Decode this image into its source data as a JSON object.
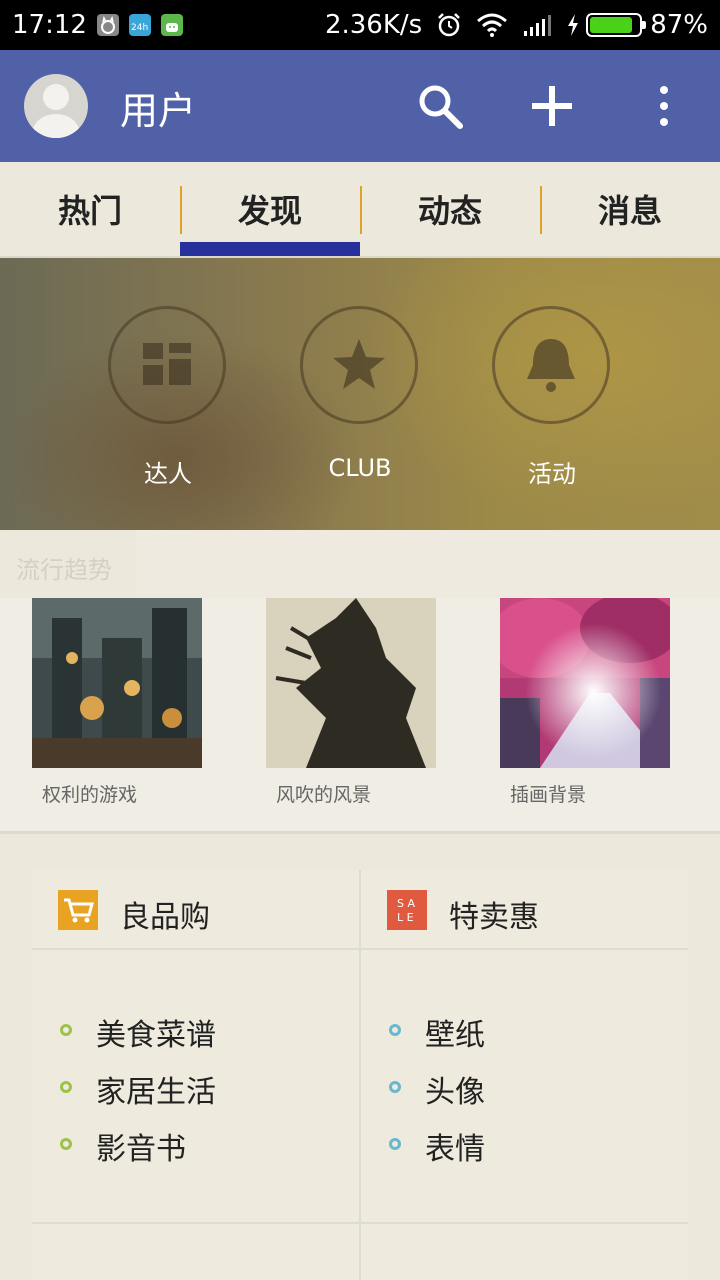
{
  "status_bar": {
    "time": "17:12",
    "net_speed": "2.36K/s",
    "battery_percent": "87%",
    "battery_level": 0.87,
    "icons": [
      "cat-notification-icon",
      "24h-notification-icon",
      "android-notification-icon",
      "alarm-icon",
      "wifi-icon",
      "signal-icon",
      "charging-icon",
      "battery-icon"
    ]
  },
  "app_bar": {
    "title": "用户",
    "color": "#5061a8",
    "actions": [
      "search-icon",
      "add-icon",
      "more-icon"
    ]
  },
  "tabs": {
    "items": [
      {
        "label": "热门",
        "active": false
      },
      {
        "label": "发现",
        "active": true
      },
      {
        "label": "动态",
        "active": false
      },
      {
        "label": "消息",
        "active": false
      }
    ],
    "indicator_color": "#28309c",
    "separator_color": "#e0a22a"
  },
  "banner": {
    "features": [
      {
        "label": "达人",
        "icon": "grid-icon"
      },
      {
        "label": "CLUB",
        "icon": "star-icon"
      },
      {
        "label": "活动",
        "icon": "bell-icon"
      }
    ]
  },
  "trending": {
    "title": "流行趋势",
    "items": [
      {
        "caption": "权利的游戏"
      },
      {
        "caption": "风吹的风景"
      },
      {
        "caption": "插画背景"
      }
    ]
  },
  "shop": {
    "left": {
      "title": "良品购",
      "icon": "cart-icon",
      "icon_color": "#e8a323",
      "dot_color": "#9dc24a",
      "items": [
        "美食菜谱",
        "家居生活",
        "影音书"
      ]
    },
    "right": {
      "title": "特卖惠",
      "icon": "sale-icon",
      "icon_text": "SALE",
      "icon_color": "#e05a3f",
      "dot_color": "#6bb7d0",
      "items": [
        "壁纸",
        "头像",
        "表情"
      ]
    }
  }
}
